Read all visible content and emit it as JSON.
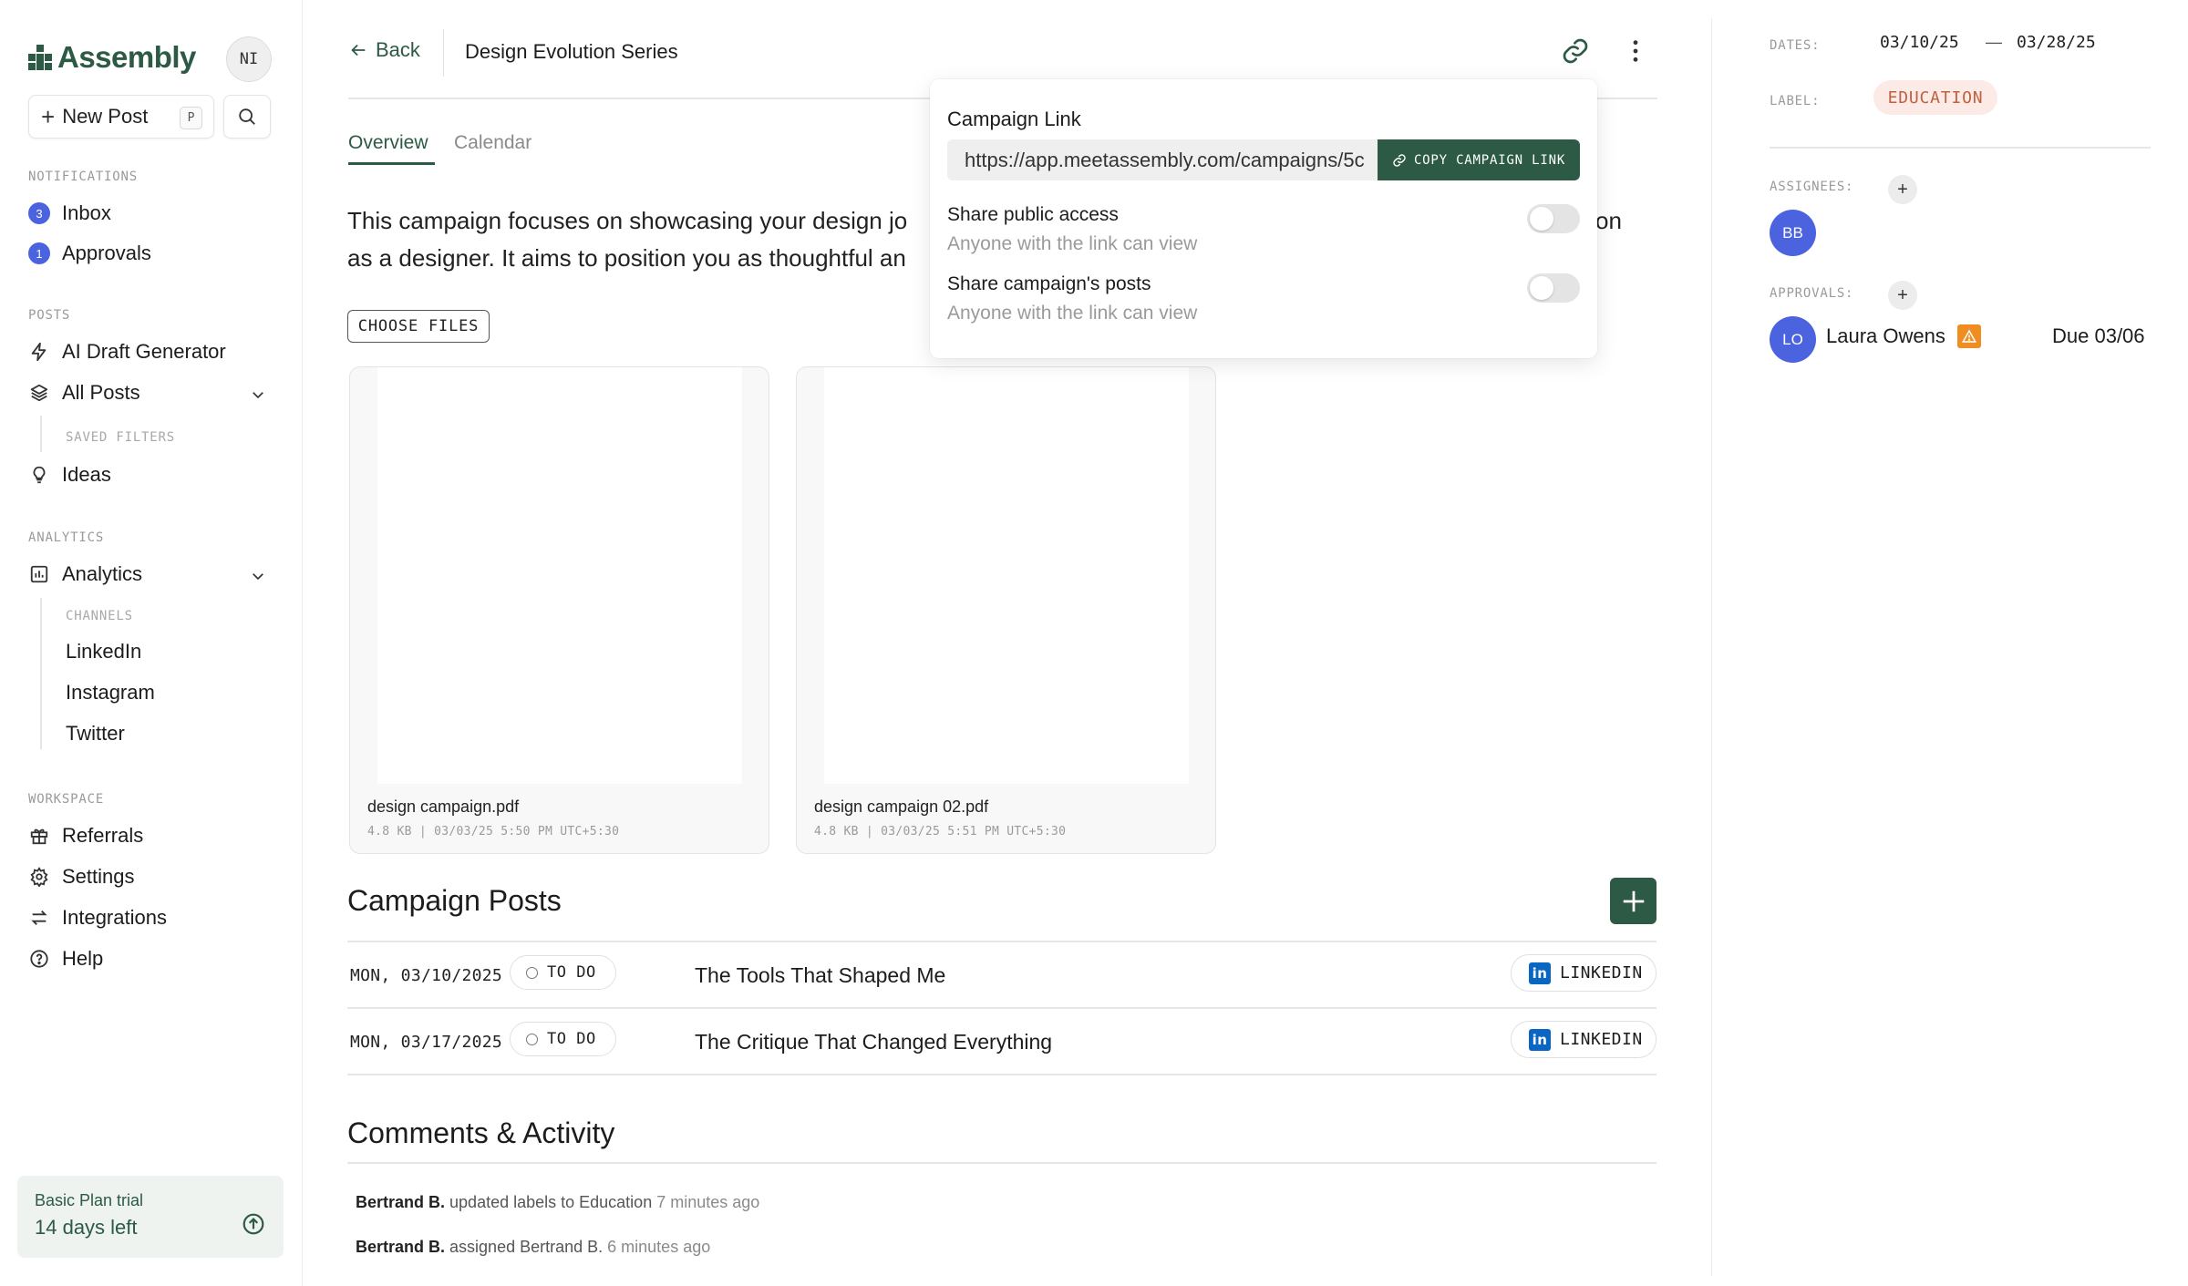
{
  "sidebar": {
    "brand": "Assembly",
    "avatar_initials": "NI",
    "new_post_label": "New Post",
    "new_post_shortcut": "P",
    "notifications_title": "NOTIFICATIONS",
    "inbox_label": "Inbox",
    "inbox_count": "3",
    "approvals_label": "Approvals",
    "approvals_count": "1",
    "posts_title": "POSTS",
    "ai_draft_label": "AI Draft Generator",
    "all_posts_label": "All Posts",
    "saved_filters_title": "SAVED FILTERS",
    "ideas_label": "Ideas",
    "analytics_title": "ANALYTICS",
    "analytics_label": "Analytics",
    "channels_title": "CHANNELS",
    "channels": [
      "LinkedIn",
      "Instagram",
      "Twitter"
    ],
    "workspace_title": "WORKSPACE",
    "referrals_label": "Referrals",
    "settings_label": "Settings",
    "integrations_label": "Integrations",
    "help_label": "Help",
    "trial_plan": "Basic Plan trial",
    "trial_days": "14 days left"
  },
  "header": {
    "back_label": "Back",
    "campaign_title": "Design Evolution Series"
  },
  "tabs": [
    {
      "label": "Overview",
      "active": true
    },
    {
      "label": "Calendar",
      "active": false
    }
  ],
  "description_line1": "This campaign focuses on showcasing your design jo",
  "description_line1_end": "on",
  "description_line2": "as a designer. It aims to position you as thoughtful an",
  "choose_files_label": "CHOOSE FILES",
  "files": [
    {
      "name": "design campaign.pdf",
      "meta": "4.8 KB | 03/03/25 5:50 PM UTC+5:30"
    },
    {
      "name": "design campaign 02.pdf",
      "meta": "4.8 KB | 03/03/25 5:51 PM UTC+5:30"
    }
  ],
  "campaign_posts": {
    "title": "Campaign Posts",
    "rows": [
      {
        "date": "MON, 03/10/2025",
        "status": "TO DO",
        "title": "The Tools That Shaped Me",
        "channel": "LINKEDIN"
      },
      {
        "date": "MON, 03/17/2025",
        "status": "TO DO",
        "title": "The Critique That Changed Everything",
        "channel": "LINKEDIN"
      }
    ]
  },
  "comments": {
    "title": "Comments & Activity",
    "items": [
      {
        "user": "Bertrand B.",
        "text": "updated labels to Education",
        "time": "7 minutes ago"
      },
      {
        "user": "Bertrand B.",
        "text": "assigned Bertrand B.",
        "time": "6 minutes ago"
      }
    ]
  },
  "popover": {
    "title": "Campaign Link",
    "url": "https://app.meetassembly.com/campaigns/5c",
    "copy_label": "COPY CAMPAIGN LINK",
    "public_access_label": "Share public access",
    "public_access_sub": "Anyone with the link can view",
    "public_access_on": false,
    "share_posts_label": "Share campaign's posts",
    "share_posts_sub": "Anyone with the link can view",
    "share_posts_on": false
  },
  "details": {
    "dates_label": "DATES:",
    "start_date": "03/10/25",
    "end_date": "03/28/25",
    "label_label": "LABEL:",
    "label_value": "EDUCATION",
    "assignees_label": "ASSIGNEES:",
    "assignee_initials": "BB",
    "approvals_label": "APPROVALS:",
    "approver_initials": "LO",
    "approver_name": "Laura Owens",
    "approval_due": "Due 03/06"
  },
  "colors": {
    "brand_green": "#2c5a45",
    "badge_blue": "#4c63e0",
    "linkedin_blue": "#0a66c2",
    "label_bg": "#fbeae6",
    "label_text": "#c0613f",
    "warning": "#f08d22"
  },
  "icons": [
    "back-arrow-icon",
    "link-icon",
    "more-vertical-icon",
    "plus-icon",
    "search-icon",
    "lightning-icon",
    "layers-icon",
    "lightbulb-icon",
    "analytics-icon",
    "gift-icon",
    "gear-icon",
    "arrows-icon",
    "help-icon",
    "chevron-down-icon",
    "arrow-up-circle-icon",
    "linkedin-icon",
    "warning-icon"
  ]
}
